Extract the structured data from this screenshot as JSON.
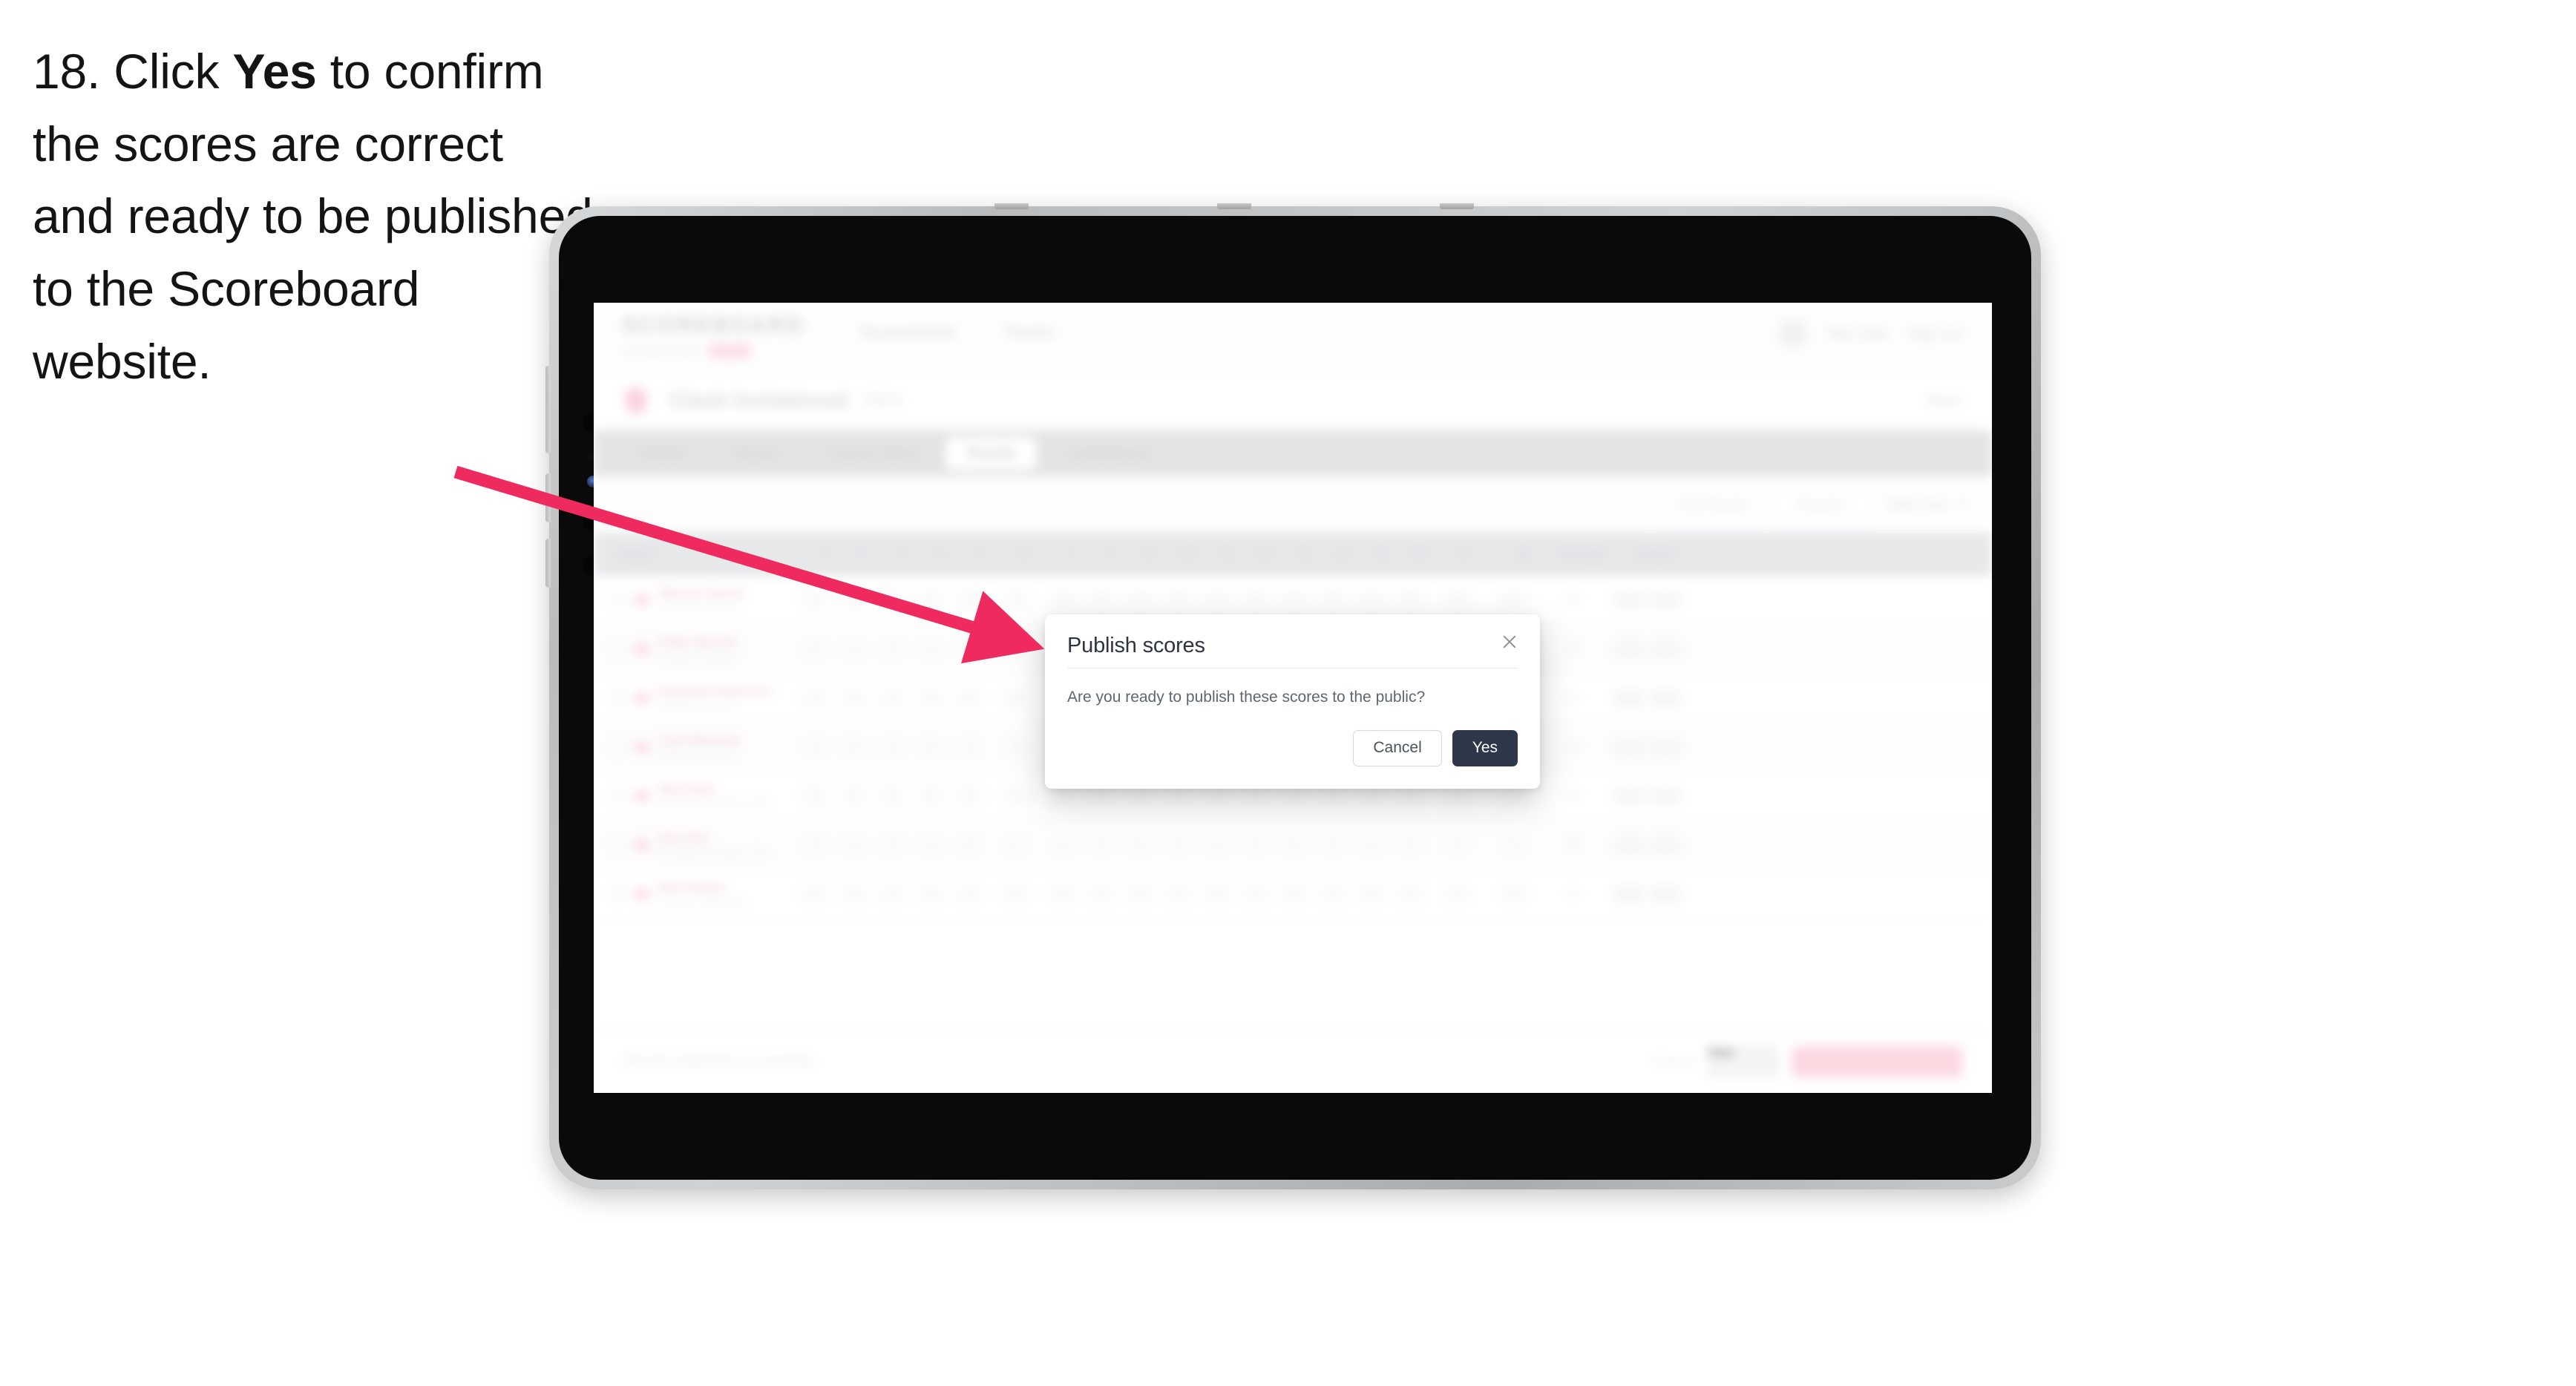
{
  "instruction": {
    "number": "18.",
    "lead": "Click",
    "emphasis": "Yes",
    "rest": "to confirm the scores are correct and ready to be published to the Scoreboard website."
  },
  "colors": {
    "arrow": "#ee2a5e",
    "modal_primary": "#2e3749",
    "brand_pink": "#f5336b",
    "bezel": "#c9cbcd"
  },
  "app": {
    "header": {
      "brand": "SCOREBOARD",
      "brand_subtitle": "Tournament Admin",
      "brand_badge": "BETA",
      "nav": [
        {
          "label": "Tournaments"
        },
        {
          "label": "Teams"
        }
      ],
      "user_name": "Test User",
      "sign_out": "Sign out"
    },
    "title_row": {
      "title": "Clash Invitational",
      "subtitle": "2024",
      "right_label": "Back"
    },
    "tabs": [
      {
        "label": "Details",
        "active": false
      },
      {
        "label": "Teams",
        "active": false
      },
      {
        "label": "Course Setup",
        "active": false
      },
      {
        "label": "Results",
        "active": true
      },
      {
        "label": "Leaderboard",
        "active": false
      }
    ],
    "filters": {
      "search_placeholder": "Search players",
      "selects": [
        {
          "label": "First Round"
        },
        {
          "label": "Round 1"
        }
      ],
      "link": "Table View"
    },
    "table": {
      "columns": [
        {
          "label": "Player",
          "kind": "player"
        },
        {
          "label": "1",
          "kind": "hole"
        },
        {
          "label": "2",
          "kind": "hole"
        },
        {
          "label": "3",
          "kind": "hole"
        },
        {
          "label": "4",
          "kind": "hole"
        },
        {
          "label": "5",
          "kind": "hole"
        },
        {
          "label": "6",
          "kind": "mid"
        },
        {
          "label": "7",
          "kind": "hole"
        },
        {
          "label": "8",
          "kind": "hole"
        },
        {
          "label": "9",
          "kind": "hole"
        },
        {
          "label": "10",
          "kind": "hole"
        },
        {
          "label": "11",
          "kind": "hole"
        },
        {
          "label": "12",
          "kind": "hole"
        },
        {
          "label": "13",
          "kind": "hole"
        },
        {
          "label": "14",
          "kind": "hole"
        },
        {
          "label": "15",
          "kind": "hole"
        },
        {
          "label": "16",
          "kind": "hole"
        },
        {
          "label": "17",
          "kind": "mid"
        },
        {
          "label": "18",
          "kind": "wide"
        },
        {
          "label": "Through",
          "kind": "total"
        },
        {
          "label": "Actions",
          "kind": "acts"
        }
      ],
      "rows": [
        {
          "player": "Warren Tanner",
          "team": "Coastal Fairways",
          "scores": [
            "4",
            "4",
            "3",
            "4",
            "5",
            "4",
            "4",
            "5",
            "3",
            "4",
            "4",
            "3",
            "5",
            "4",
            "4",
            "4",
            "5",
            "4"
          ],
          "through": "18",
          "total": "72"
        },
        {
          "player": "Peter Parrish",
          "team": "Coastal Fairways",
          "scores": [
            "5",
            "4",
            "4",
            "4",
            "4",
            "4",
            "3",
            "5",
            "4",
            "4",
            "5",
            "4",
            "4",
            "4",
            "4",
            "5",
            "4",
            "3"
          ],
          "through": "18",
          "total": "74"
        },
        {
          "player": "Deborah Anderson",
          "team": "Highland Greens",
          "scores": [
            "4",
            "5",
            "4",
            "3",
            "5",
            "4",
            "4",
            "4",
            "4",
            "5",
            "4",
            "4",
            "3",
            "5",
            "4",
            "4",
            "4",
            "4"
          ],
          "through": "18",
          "total": "73"
        },
        {
          "player": "Cole Newman",
          "team": "Highland Greens",
          "scores": [
            "4",
            "4",
            "4",
            "5",
            "4",
            "5",
            "4",
            "4",
            "5",
            "3",
            "4",
            "4",
            "4",
            "4",
            "5",
            "4",
            "4",
            "4"
          ],
          "through": "18",
          "total": "75"
        },
        {
          "player": "Mya Hunt",
          "team": "Riverbend Country Club",
          "scores": [
            "3",
            "4",
            "5",
            "4",
            "4",
            "4",
            "5",
            "4",
            "4",
            "4",
            "4",
            "5",
            "4",
            "3",
            "4",
            "5",
            "4",
            "4"
          ],
          "through": "18",
          "total": "74"
        },
        {
          "player": "Sue Kim",
          "team": "Riverbend Country Club",
          "scores": [
            "4",
            "4",
            "4",
            "4",
            "5",
            "4",
            "4",
            "3",
            "5",
            "4",
            "4",
            "4",
            "5",
            "4",
            "4",
            "4",
            "3",
            "5"
          ],
          "through": "18",
          "total": "73"
        },
        {
          "player": "Bob Dubey",
          "team": "Summit Links Club",
          "scores": [
            "5",
            "3",
            "4",
            "4",
            "4",
            "5",
            "4",
            "4",
            "4",
            "4",
            "5",
            "4",
            "4",
            "5",
            "4",
            "4",
            "4",
            "4"
          ],
          "through": "18",
          "total": "76"
        }
      ],
      "action_buttons": [
        "Edit",
        "View"
      ]
    },
    "footer": {
      "note": "Results published successfully",
      "link": "Cancel",
      "secondary_button": "Save",
      "primary_button": "Publish to Scoreboard"
    }
  },
  "modal": {
    "title": "Publish scores",
    "message": "Are you ready to publish these scores to the public?",
    "cancel_label": "Cancel",
    "confirm_label": "Yes",
    "close_icon": "close-icon"
  }
}
